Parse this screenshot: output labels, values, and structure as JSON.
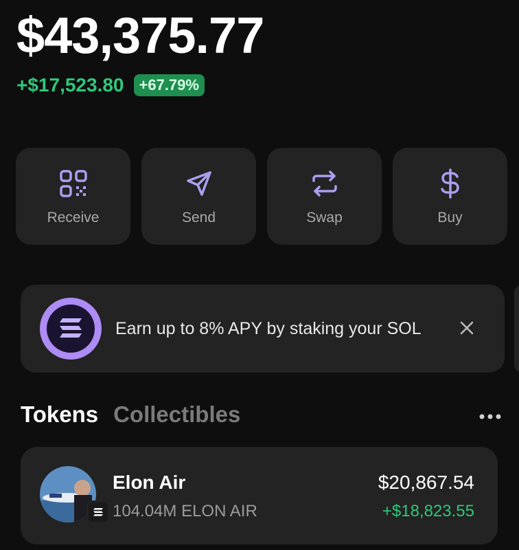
{
  "portfolio": {
    "balance": "$43,375.77",
    "change_amount": "+$17,523.80",
    "change_percent": "+67.79%"
  },
  "actions": [
    {
      "label": "Receive",
      "icon": "qr-code-icon"
    },
    {
      "label": "Send",
      "icon": "send-icon"
    },
    {
      "label": "Swap",
      "icon": "swap-icon"
    },
    {
      "label": "Buy",
      "icon": "dollar-icon"
    }
  ],
  "promo": {
    "text": "Earn up to 8% APY by staking your SOL",
    "icon": "solana-logo-icon"
  },
  "tabs": [
    {
      "label": "Tokens",
      "active": true
    },
    {
      "label": "Collectibles",
      "active": false
    }
  ],
  "tokens": [
    {
      "name": "Elon Air",
      "amount": "104.04M ELON AIR",
      "value": "$20,867.54",
      "pnl": "+$18,823.55"
    }
  ],
  "colors": {
    "background": "#0e0e0e",
    "card": "#232323",
    "accent": "#ab9ff2",
    "positive": "#2ec87a"
  }
}
